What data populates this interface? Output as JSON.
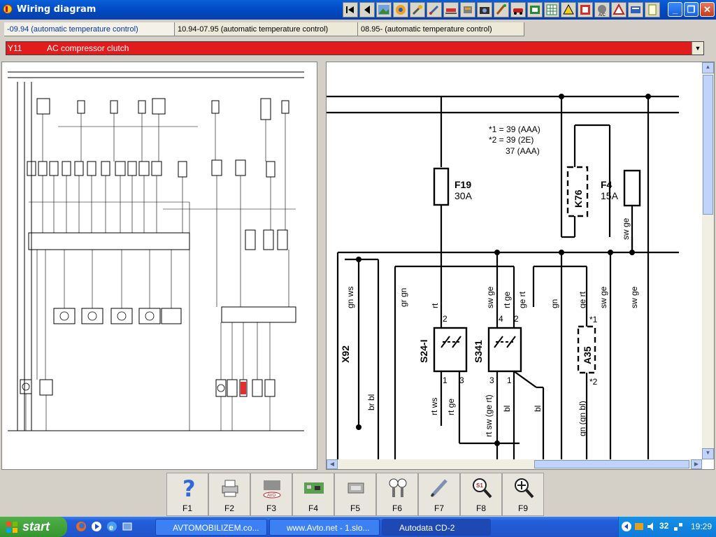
{
  "window": {
    "title": "Wiring diagram"
  },
  "tabs": [
    {
      "label": "-09.94 (automatic temperature control)"
    },
    {
      "label": "10.94-07.95 (automatic temperature control)"
    },
    {
      "label": "08.95- (automatic temperature control)"
    }
  ],
  "component_select": {
    "code": "Y11",
    "description": "AC compressor clutch"
  },
  "diagram": {
    "note_lines": [
      "*1 = 39 (AAA)",
      "*2 = 39 (2E)",
      "37 (AAA)"
    ],
    "fuses": [
      {
        "id": "F19",
        "rating": "30A"
      },
      {
        "id": "F4",
        "rating": "15A"
      }
    ],
    "components": [
      "K76",
      "X92",
      "S24-I",
      "S341",
      "A35"
    ],
    "wire_labels": [
      "gn ws",
      "gr gn",
      "rt",
      "sw ge",
      "rt ge",
      "ge rt",
      "gn",
      "ge rt",
      "sw ge",
      "sw ge",
      "br bl",
      "rt ws",
      "rt ge",
      "rt sw (ge rt)",
      "bl",
      "bl",
      "gn (gn bl)",
      "sw ge"
    ],
    "pin_labels": [
      "2",
      "1",
      "3",
      "4",
      "2",
      "3",
      "1",
      "*1",
      "*2"
    ]
  },
  "function_keys": [
    {
      "label": "F1",
      "icon": "help-icon"
    },
    {
      "label": "F2",
      "icon": "print-icon"
    },
    {
      "label": "F3",
      "icon": "avto-icon"
    },
    {
      "label": "F4",
      "icon": "circuit-board-icon"
    },
    {
      "label": "F5",
      "icon": "component-icon"
    },
    {
      "label": "F6",
      "icon": "gauges-icon"
    },
    {
      "label": "F7",
      "icon": "pen-icon"
    },
    {
      "label": "F8",
      "icon": "zoom-component-icon"
    },
    {
      "label": "F9",
      "icon": "zoom-locate-icon"
    }
  ],
  "taskbar": {
    "start_label": "start",
    "tasks": [
      {
        "label": "AVTOMOBILIZEM.co..."
      },
      {
        "label": "www.Avto.net - 1.slo..."
      },
      {
        "label": "Autodata CD-2"
      }
    ],
    "tray_number": "32",
    "clock": "19:29"
  },
  "colors": {
    "selection_red": "#e01c1c",
    "titlebar_blue": "#0149c2"
  }
}
